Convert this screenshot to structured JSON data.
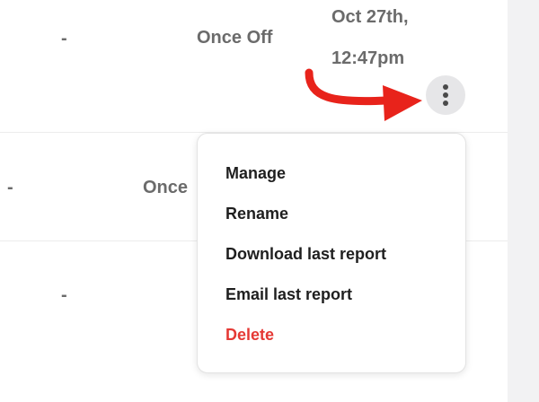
{
  "rows": [
    {
      "col_a": "-",
      "frequency": "Once Off",
      "timestamp_line1": "Oct 27th,",
      "timestamp_line2": "12:47pm"
    },
    {
      "col_a": "-",
      "frequency": "Once"
    },
    {
      "col_a": "-"
    }
  ],
  "actions_button": {
    "icon": "more-vertical-icon"
  },
  "annotation": {
    "arrow_color": "#e8231b"
  },
  "menu": {
    "items": [
      {
        "label": "Manage"
      },
      {
        "label": "Rename"
      },
      {
        "label": "Download last report"
      },
      {
        "label": "Email last report"
      },
      {
        "label": "Delete",
        "color": "#e53935"
      }
    ]
  }
}
